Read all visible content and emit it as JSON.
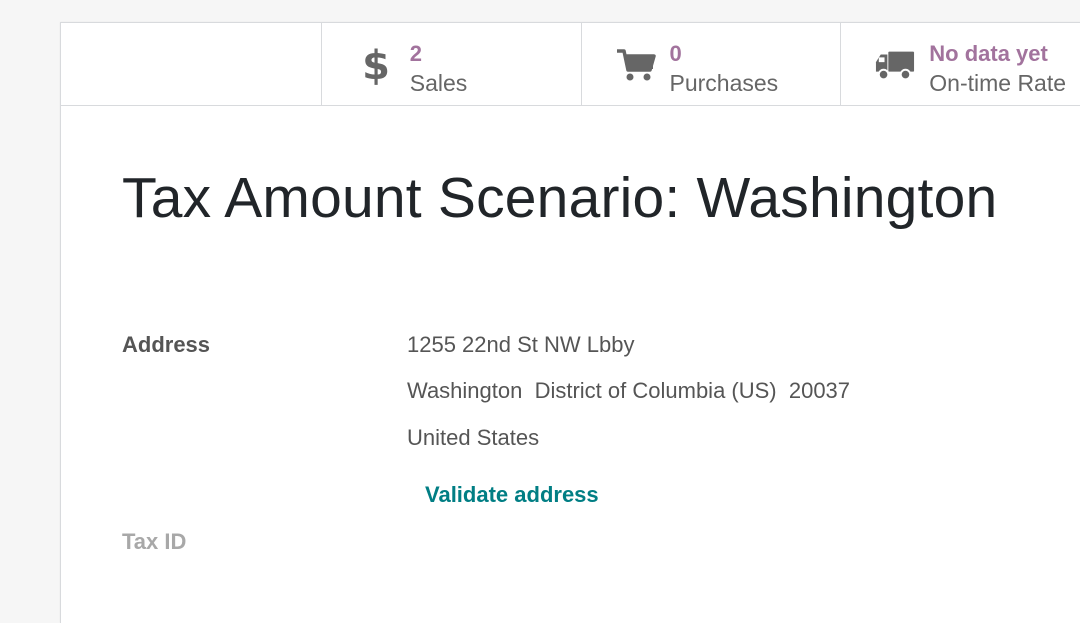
{
  "stat_buttons": [
    {
      "value": "2",
      "label": "Sales",
      "icon": "dollar-icon",
      "color": "#a2739d"
    },
    {
      "value": "0",
      "label": "Purchases",
      "icon": "shopping-cart-icon",
      "color": "#a2739d"
    },
    {
      "value": "No data yet",
      "label": "On-time Rate",
      "icon": "truck-icon",
      "color": "#a2739d"
    }
  ],
  "title": "Tax Amount Scenario: Washington",
  "address": {
    "label": "Address",
    "street": "1255 22nd St NW Lbby",
    "city_line": "Washington  District of Columbia (US)  20037",
    "country": "United States",
    "validate_label": "Validate address",
    "validate_color": "#017e84"
  },
  "tax_id": {
    "label": "Tax ID"
  }
}
